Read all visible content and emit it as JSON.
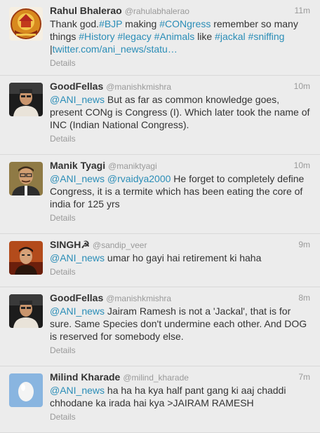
{
  "tweets": [
    {
      "avatar": "rahul-logo",
      "name": "Rahul Bhalerao",
      "handle": "@rahulabhalerao",
      "time": "11m",
      "details": "Details",
      "segments": [
        {
          "text": "Thank god.",
          "link": false
        },
        {
          "text": "#BJP",
          "link": true
        },
        {
          "text": " making ",
          "link": false
        },
        {
          "text": "#CONgress",
          "link": true
        },
        {
          "text": " remember so many things ",
          "link": false
        },
        {
          "text": "#History",
          "link": true
        },
        {
          "text": " ",
          "link": false
        },
        {
          "text": "#legacy",
          "link": true
        },
        {
          "text": " ",
          "link": false
        },
        {
          "text": "#Animals",
          "link": true
        },
        {
          "text": " like ",
          "link": false
        },
        {
          "text": "#jackal",
          "link": true
        },
        {
          "text": " ",
          "link": false
        },
        {
          "text": "#sniffing",
          "link": true
        },
        {
          "text": " |",
          "link": false
        },
        {
          "text": "twitter.com/ani_news/statu…",
          "link": true
        }
      ]
    },
    {
      "avatar": "goodfellas-photo",
      "name": "GoodFellas",
      "handle": "@manishkmishra",
      "time": "10m",
      "details": "Details",
      "segments": [
        {
          "text": "@ANI_news",
          "link": true
        },
        {
          "text": " But as far as common knowledge goes, present CONg is Congress (I). Which later took the name of INC (Indian National Congress).",
          "link": false
        }
      ]
    },
    {
      "avatar": "manik-photo",
      "name": "Manik Tyagi",
      "handle": "@maniktyagi",
      "time": "10m",
      "details": "Details",
      "segments": [
        {
          "text": "@ANI_news",
          "link": true
        },
        {
          "text": " ",
          "link": false
        },
        {
          "text": "@rvaidya2000",
          "link": true
        },
        {
          "text": " He forget to completely define Congress, it is a termite which has been eating the core of india for 125 yrs",
          "link": false
        }
      ]
    },
    {
      "avatar": "singh-photo",
      "name": "SINGH☭",
      "handle": "@sandip_veer",
      "time": "9m",
      "details": "Details",
      "segments": [
        {
          "text": "@ANI_news",
          "link": true
        },
        {
          "text": " umar ho gayi hai  retirement ki haha",
          "link": false
        }
      ]
    },
    {
      "avatar": "goodfellas-photo",
      "name": "GoodFellas",
      "handle": "@manishkmishra",
      "time": "8m",
      "details": "Details",
      "segments": [
        {
          "text": "@ANI_news",
          "link": true
        },
        {
          "text": " Jairam Ramesh is not a 'Jackal', that is for sure. Same Species don't undermine each other. And DOG is reserved for somebody else.",
          "link": false
        }
      ]
    },
    {
      "avatar": "default-egg",
      "name": "Milind Kharade",
      "handle": "@milind_kharade",
      "time": "7m",
      "details": "Details",
      "segments": [
        {
          "text": "@ANI_news",
          "link": true
        },
        {
          "text": " ha ha ha kya half pant gang ki aaj chaddi chhodane ka irada hai kya >JAIRAM RAMESH",
          "link": false
        }
      ]
    }
  ],
  "colors": {
    "link": "#2a8db7",
    "name": "#333333",
    "meta": "#999999",
    "background": "#ececec"
  }
}
